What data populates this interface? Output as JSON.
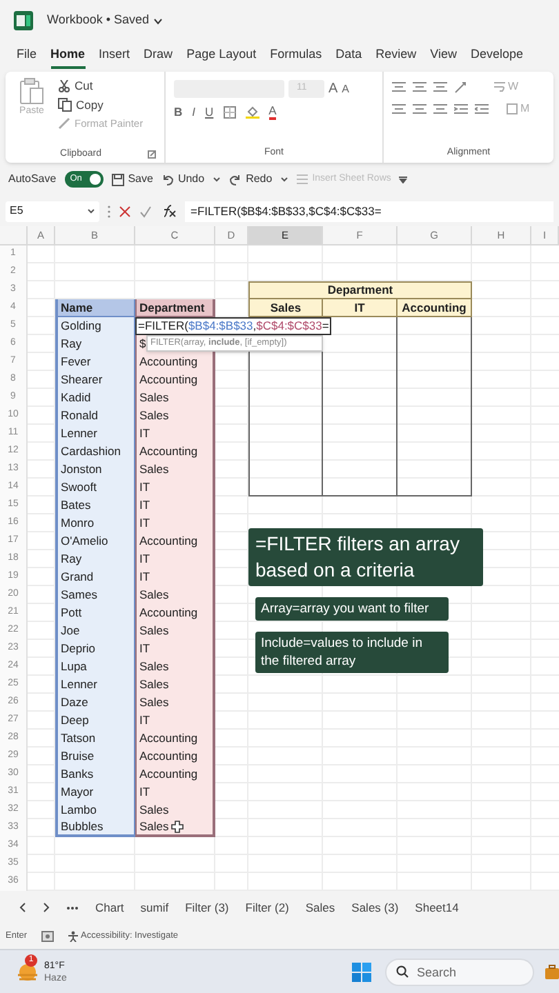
{
  "title_bar": {
    "title": "Workbook • Saved"
  },
  "ribbon_tabs": [
    {
      "label": "File",
      "selected": false
    },
    {
      "label": "Home",
      "selected": true
    },
    {
      "label": "Insert",
      "selected": false
    },
    {
      "label": "Draw",
      "selected": false
    },
    {
      "label": "Page Layout",
      "selected": false
    },
    {
      "label": "Formulas",
      "selected": false
    },
    {
      "label": "Data",
      "selected": false
    },
    {
      "label": "Review",
      "selected": false
    },
    {
      "label": "View",
      "selected": false
    },
    {
      "label": "Develope",
      "selected": false
    }
  ],
  "ribbon": {
    "clipboard": {
      "paste": "Paste",
      "cut": "Cut",
      "copy": "Copy",
      "format_painter": "Format Painter",
      "group_label": "Clipboard"
    },
    "font": {
      "size": "11",
      "grow": "A",
      "shrink": "A",
      "bold": "B",
      "italic": "I",
      "underline": "U",
      "font_color": "A",
      "group_label": "Font"
    },
    "alignment": {
      "wrap_text": "W",
      "merge": "M",
      "group_label": "Alignment"
    }
  },
  "quick_access": {
    "autosave": {
      "label": "AutoSave",
      "on": true,
      "state_text": "On"
    },
    "save": "Save",
    "undo": "Undo",
    "redo": "Redo",
    "insert_rows": "Insert Sheet Rows"
  },
  "formula_bar": {
    "name_box": "E5",
    "formula": "=FILTER($B$4:$B$33,$C$4:$C$33="
  },
  "sheet": {
    "columns": [
      {
        "label": "A",
        "selected": false
      },
      {
        "label": "B",
        "selected": false
      },
      {
        "label": "C",
        "selected": false
      },
      {
        "label": "D",
        "selected": false
      },
      {
        "label": "E",
        "selected": true
      },
      {
        "label": "F",
        "selected": false
      },
      {
        "label": "G",
        "selected": false
      },
      {
        "label": "H",
        "selected": false
      },
      {
        "label": "I",
        "selected": false
      }
    ],
    "row_numbers": [
      "1",
      "2",
      "3",
      "4",
      "5",
      "6",
      "7",
      "8",
      "9",
      "10",
      "11",
      "12",
      "13",
      "14",
      "15",
      "16",
      "17",
      "18",
      "19",
      "20",
      "21",
      "22",
      "23",
      "24",
      "25",
      "26",
      "27",
      "28",
      "29",
      "30",
      "31",
      "32",
      "33",
      "34",
      "35",
      "36"
    ]
  },
  "name_table": {
    "headers": [
      "Name",
      "Department"
    ],
    "rows": [
      {
        "name": "Golding",
        "kind": "editing",
        "segments": [
          {
            "text": "=FILTER("
          },
          {
            "text": "$B$4:$B$33",
            "color": "#4a78c8"
          },
          {
            "text": ","
          },
          {
            "text": "$C$4:$C$33",
            "color": "#b04a6a"
          },
          {
            "text": "="
          }
        ]
      },
      {
        "name": "Ray",
        "kind": "hint",
        "department": "$",
        "tooltip": "FILTER(array, **include**, [if_empty])"
      },
      {
        "name": "Fever",
        "kind": "value",
        "department": "Accounting"
      },
      {
        "name": "Shearer",
        "kind": "value",
        "department": "Accounting"
      },
      {
        "name": "Kadid",
        "kind": "value",
        "department": "Sales"
      },
      {
        "name": "Ronald",
        "kind": "value",
        "department": "Sales"
      },
      {
        "name": "Lenner",
        "kind": "value",
        "department": "IT"
      },
      {
        "name": "Cardashion",
        "kind": "value",
        "department": "Accounting"
      },
      {
        "name": "Jonston",
        "kind": "value",
        "department": "Sales"
      },
      {
        "name": "Swooft",
        "kind": "value",
        "department": "IT"
      },
      {
        "name": "Bates",
        "kind": "value",
        "department": "IT"
      },
      {
        "name": "Monro",
        "kind": "value",
        "department": "IT"
      },
      {
        "name": "O'Amelio",
        "kind": "value",
        "department": "Accounting"
      },
      {
        "name": "Ray",
        "kind": "value",
        "department": "IT"
      },
      {
        "name": "Grand",
        "kind": "value",
        "department": "IT"
      },
      {
        "name": "Sames",
        "kind": "value",
        "department": "Sales"
      },
      {
        "name": "Pott",
        "kind": "value",
        "department": "Accounting"
      },
      {
        "name": "Joe",
        "kind": "value",
        "department": "Sales"
      },
      {
        "name": "Deprio",
        "kind": "value",
        "department": "IT"
      },
      {
        "name": "Lupa",
        "kind": "value",
        "department": "Sales"
      },
      {
        "name": "Lenner",
        "kind": "value",
        "department": "Sales"
      },
      {
        "name": "Daze",
        "kind": "value",
        "department": "Sales"
      },
      {
        "name": "Deep",
        "kind": "value",
        "department": "IT"
      },
      {
        "name": "Tatson",
        "kind": "value",
        "department": "Accounting"
      },
      {
        "name": "Bruise",
        "kind": "value",
        "department": "Accounting"
      },
      {
        "name": "Banks",
        "kind": "value",
        "department": "Accounting"
      },
      {
        "name": "Mayor",
        "kind": "value",
        "department": "IT"
      },
      {
        "name": "Lambo",
        "kind": "value",
        "department": "Sales"
      },
      {
        "name": "Bubbles",
        "kind": "value",
        "department": "Sales"
      }
    ]
  },
  "summary_table": {
    "title": "Department",
    "columns": [
      "Sales",
      "IT",
      "Accounting"
    ]
  },
  "callouts": [
    {
      "kind": "headline",
      "text": "=FILTER filters an array based on a criteria"
    },
    {
      "kind": "note",
      "text": "Array=array you want to filter"
    },
    {
      "kind": "note",
      "text": "Include=values to include in the filtered array"
    }
  ],
  "sheet_tabs": [
    "Chart",
    "sumif",
    "Filter (3)",
    "Filter (2)",
    "Sales",
    "Sales (3)",
    "Sheet14"
  ],
  "status_bar": {
    "mode": "Enter",
    "accessibility": "Accessibility: Investigate"
  },
  "taskbar": {
    "weather": {
      "temperature": "81°F",
      "condition": "Haze",
      "badge": "1"
    },
    "search": {
      "placeholder": "Search"
    }
  }
}
